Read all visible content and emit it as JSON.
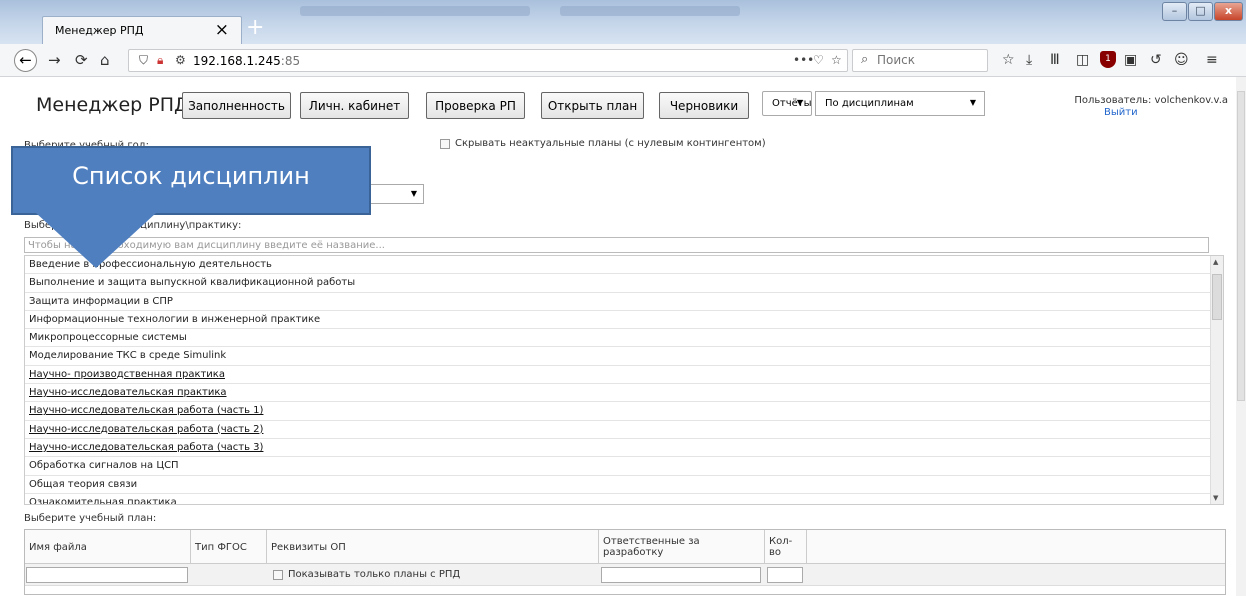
{
  "browser": {
    "tab_title": "Менеджер РПД",
    "tab_close": "×",
    "new_tab": "+",
    "window_buttons": [
      "–",
      "□",
      "x"
    ],
    "url_host": "192.168.1.245",
    "url_port": ":85",
    "search_placeholder": "Поиск",
    "notification_count": "1"
  },
  "app": {
    "title": "Менеджер РПД",
    "buttons": [
      "Заполненность",
      "Личн. кабинет",
      "Проверка РП",
      "Открыть план",
      "Черновики"
    ],
    "reports_label": "Отчёты",
    "report_mode": "По дисциплинам",
    "user": "Пользователь: volchenkov.v.a",
    "logout": "Выйти"
  },
  "filters": {
    "year_label": "Выберите учебный год:",
    "hide_inactive": "Скрывать неактуальные планы (с нулевым контингентом)",
    "discipline_label": "Выберите модуль\\дисциплину\\практику:",
    "search_placeholder": "Чтобы найти необходимую вам дисциплину введите её название..."
  },
  "disciplines": [
    {
      "name": "Введение в профессиональную деятельность",
      "link": false
    },
    {
      "name": "Выполнение и защита выпускной квалификационной работы",
      "link": false
    },
    {
      "name": "Защита информации в СПР",
      "link": false
    },
    {
      "name": "Информационные технологии в инженерной практике",
      "link": false
    },
    {
      "name": "Микропроцессорные системы",
      "link": false
    },
    {
      "name": "Моделирование ТКС в среде Simulink",
      "link": false
    },
    {
      "name": "Научно- производственная практика",
      "link": true
    },
    {
      "name": "Научно-исследовательская практика",
      "link": true
    },
    {
      "name": "Научно-исследовательская работа (часть 1)",
      "link": true
    },
    {
      "name": "Научно-исследовательская работа (часть 2)",
      "link": true
    },
    {
      "name": "Научно-исследовательская работа (часть 3)",
      "link": true
    },
    {
      "name": "Обработка сигналов на ЦСП",
      "link": false
    },
    {
      "name": "Общая теория связи",
      "link": false
    },
    {
      "name": "Ознакомительная практика",
      "link": false
    }
  ],
  "plan": {
    "label": "Выберите учебный план:",
    "columns": [
      "Имя файла",
      "Тип ФГОС",
      "Реквизиты ОП",
      "Ответственные за разработку",
      "Кол-во"
    ],
    "only_rpd": "Показывать только планы с РПД"
  },
  "callout": {
    "text": "Список дисциплин",
    "color": "#4f7fbf"
  }
}
